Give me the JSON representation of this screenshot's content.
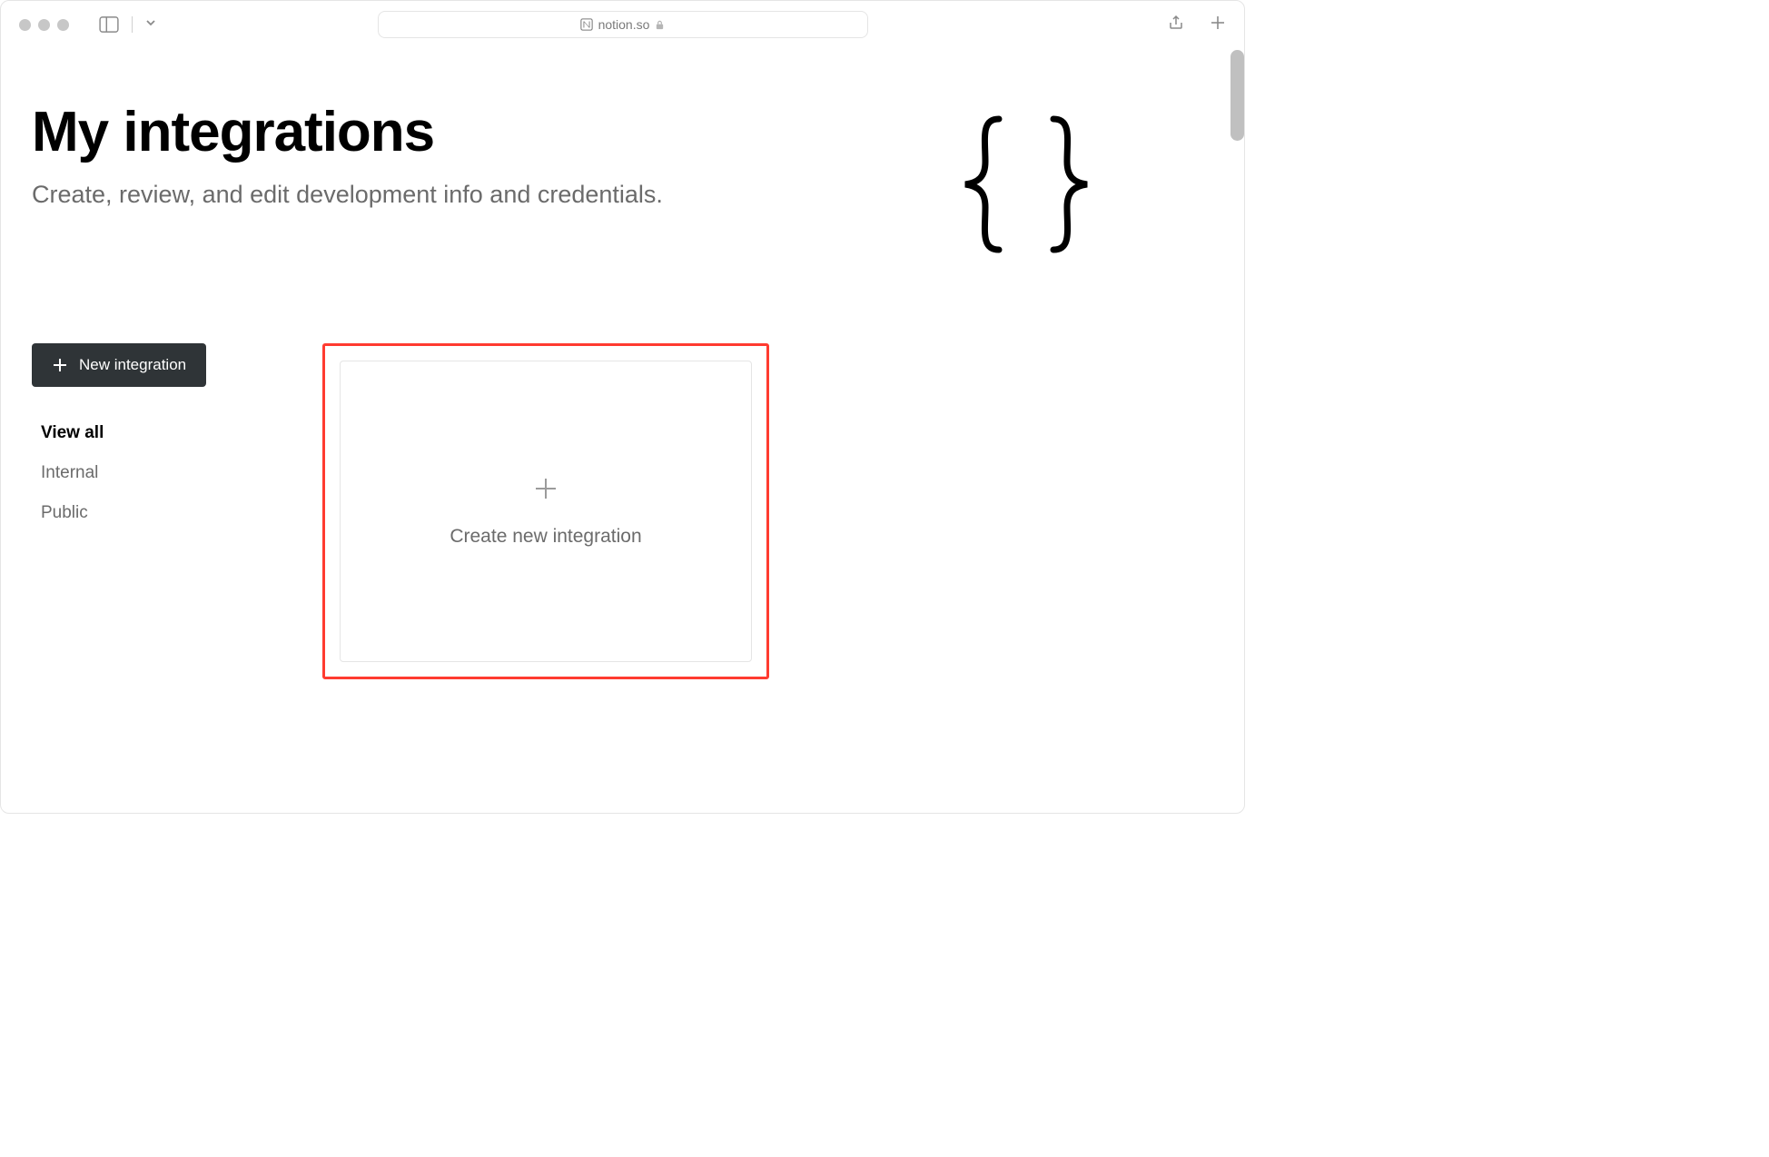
{
  "browser": {
    "address": "notion.so"
  },
  "page": {
    "title": "My integrations",
    "subtitle": "Create, review, and edit development info and credentials."
  },
  "sidebar": {
    "new_button_label": "New integration",
    "filters": [
      {
        "label": "View all",
        "active": true
      },
      {
        "label": "Internal",
        "active": false
      },
      {
        "label": "Public",
        "active": false
      }
    ]
  },
  "main": {
    "create_card_label": "Create new integration"
  },
  "colors": {
    "highlight": "#ff3b30",
    "button_bg": "#2f3437",
    "text_muted": "#6b6b6b"
  }
}
